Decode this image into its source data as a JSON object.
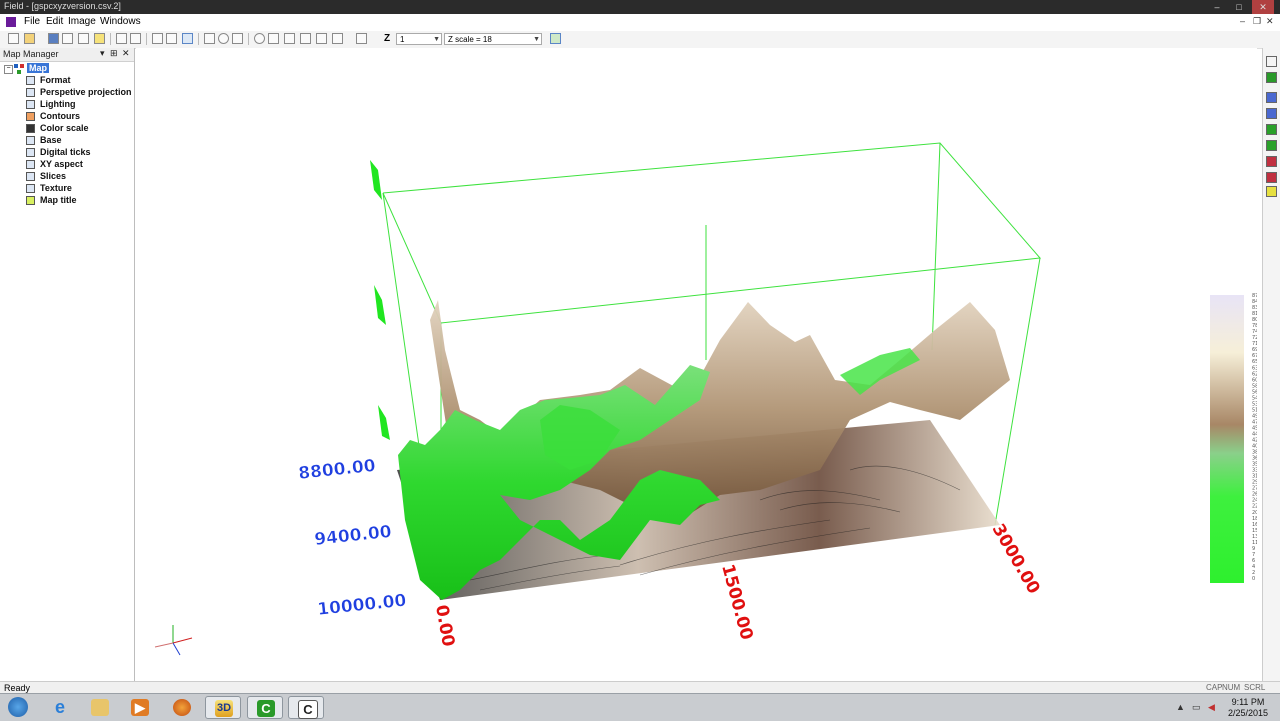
{
  "window": {
    "title": "Field - [gspcxyzversion.csv.2]"
  },
  "titlebar_controls": {
    "min": "–",
    "max": "□",
    "close": "✕"
  },
  "menu": {
    "items": [
      "File",
      "Edit",
      "Image",
      "Windows"
    ],
    "right_controls": {
      "min": "–",
      "restore": "❐",
      "close": "✕"
    }
  },
  "toolbar": {
    "z_label": "Z",
    "z_value": "1",
    "z_scale": "Z scale = 18"
  },
  "map_manager": {
    "title": "Map Manager",
    "pin": "⊞",
    "close": "✕",
    "root": "Map",
    "items": [
      "Format",
      "Perspetive projection",
      "Lighting",
      "Contours",
      "Color scale",
      "Base",
      "Digital ticks",
      "XY aspect",
      "Slices",
      "Texture",
      "Map title"
    ]
  },
  "plot": {
    "y_ticks": [
      "8800.00",
      "9400.00",
      "10000.00"
    ],
    "x_ticks": [
      "0.00",
      "1500.00",
      "3000.00"
    ],
    "color_scale_labels": [
      "87",
      "84",
      "83",
      "81",
      "80",
      "78",
      "74",
      "72",
      "71",
      "69",
      "67",
      "65",
      "63",
      "62",
      "60",
      "58",
      "56",
      "54",
      "53",
      "51",
      "49",
      "47",
      "45",
      "44",
      "42",
      "40",
      "38",
      "36",
      "35",
      "33",
      "31",
      "29",
      "27",
      "26",
      "24",
      "22",
      "20",
      "18",
      "16",
      "15",
      "13",
      "11",
      "9",
      "7",
      "6",
      "4",
      "2",
      "0"
    ],
    "colors": {
      "green": "#19e019",
      "tan": "#a88766",
      "bright_green": "#3cf03c"
    }
  },
  "status": {
    "text": "Ready",
    "indicators": [
      "CAP",
      "NUM",
      "SCRL"
    ]
  },
  "taskbar": {
    "apps": [
      "start-button",
      "internet-explorer",
      "file-explorer",
      "media-player",
      "firefox",
      "3d-field",
      "app-c-green",
      "app-c-white"
    ],
    "app_3d_text": "3D",
    "app_c_text": "C",
    "clock_time": "9:11 PM",
    "clock_date": "2/25/2015"
  }
}
